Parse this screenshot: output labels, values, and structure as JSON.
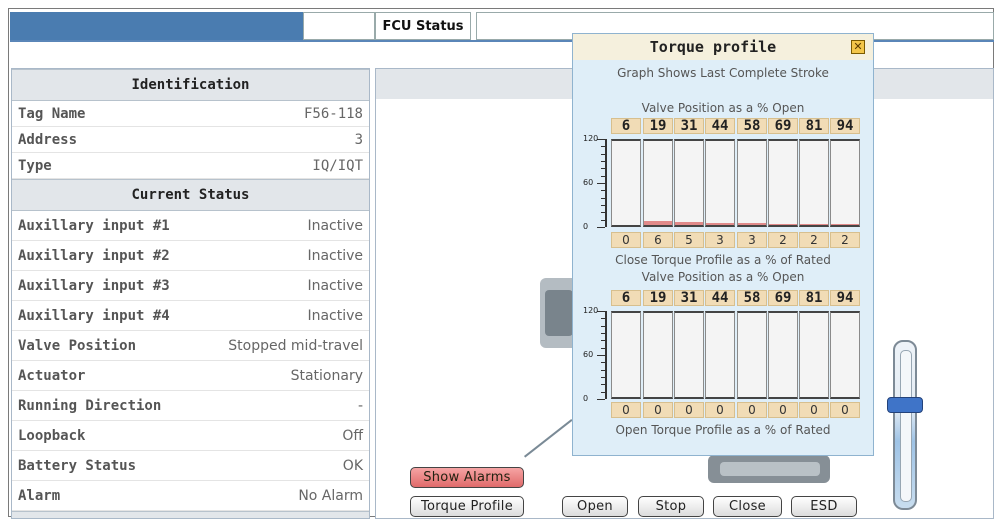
{
  "header": {
    "title": "FCU Status"
  },
  "identification": {
    "heading": "Identification",
    "rows": [
      {
        "label": "Tag Name",
        "value": "F56-118"
      },
      {
        "label": "Address",
        "value": "3"
      },
      {
        "label": "Type",
        "value": "IQ/IQT"
      }
    ]
  },
  "current_status": {
    "heading": "Current Status",
    "rows": [
      {
        "label": "Auxillary input #1",
        "value": "Inactive"
      },
      {
        "label": "Auxillary input #2",
        "value": "Inactive"
      },
      {
        "label": "Auxillary input #3",
        "value": "Inactive"
      },
      {
        "label": "Auxillary input #4",
        "value": "Inactive"
      },
      {
        "label": "Valve Position",
        "value": "Stopped mid-travel"
      },
      {
        "label": "Actuator",
        "value": "Stationary"
      },
      {
        "label": "Running Direction",
        "value": "-"
      },
      {
        "label": "Loopback",
        "value": "Off"
      },
      {
        "label": "Battery Status",
        "value": "OK"
      },
      {
        "label": "Alarm",
        "value": "No Alarm"
      }
    ]
  },
  "buttons": {
    "show_alarms": "Show Alarms",
    "torque_profile": "Torque Profile",
    "open": "Open",
    "stop": "Stop",
    "close": "Close",
    "esd": "ESD"
  },
  "popup": {
    "title": "Torque profile",
    "close_icon": "close-icon",
    "subtitle": "Graph Shows Last Complete Stroke",
    "close_chart": {
      "heading": "Valve Position as a % Open",
      "footer": "Close Torque Profile as a % of Rated"
    },
    "open_chart": {
      "heading": "Valve Position as a % Open",
      "footer": "Open Torque Profile as a % of Rated"
    }
  },
  "chart_data": [
    {
      "type": "bar",
      "title": "Valve Position as a % Open",
      "xlabel": "Close Torque Profile as a % of Rated",
      "categories": [
        "6",
        "19",
        "31",
        "44",
        "58",
        "69",
        "81",
        "94"
      ],
      "values": [
        0,
        6,
        5,
        3,
        3,
        2,
        2,
        2
      ],
      "ylim": [
        0,
        120
      ],
      "yticks": [
        "120",
        "60",
        "0"
      ]
    },
    {
      "type": "bar",
      "title": "Valve Position as a % Open",
      "xlabel": "Open Torque Profile as a % of Rated",
      "categories": [
        "6",
        "19",
        "31",
        "44",
        "58",
        "69",
        "81",
        "94"
      ],
      "values": [
        0,
        0,
        0,
        0,
        0,
        0,
        0,
        0
      ],
      "ylim": [
        0,
        120
      ],
      "yticks": [
        "120",
        "60",
        "0"
      ]
    }
  ],
  "colors": {
    "header_blue": "#4a7cb0",
    "popup_bg": "#dfeef8",
    "bar_fill": "#e08a8a",
    "cell_bg": "#f1dcb6",
    "alarm_button": "#e06a6a",
    "slider_thumb": "#3f74c8"
  },
  "slider": {
    "icon": "slider-thumb",
    "level": 0.6
  }
}
